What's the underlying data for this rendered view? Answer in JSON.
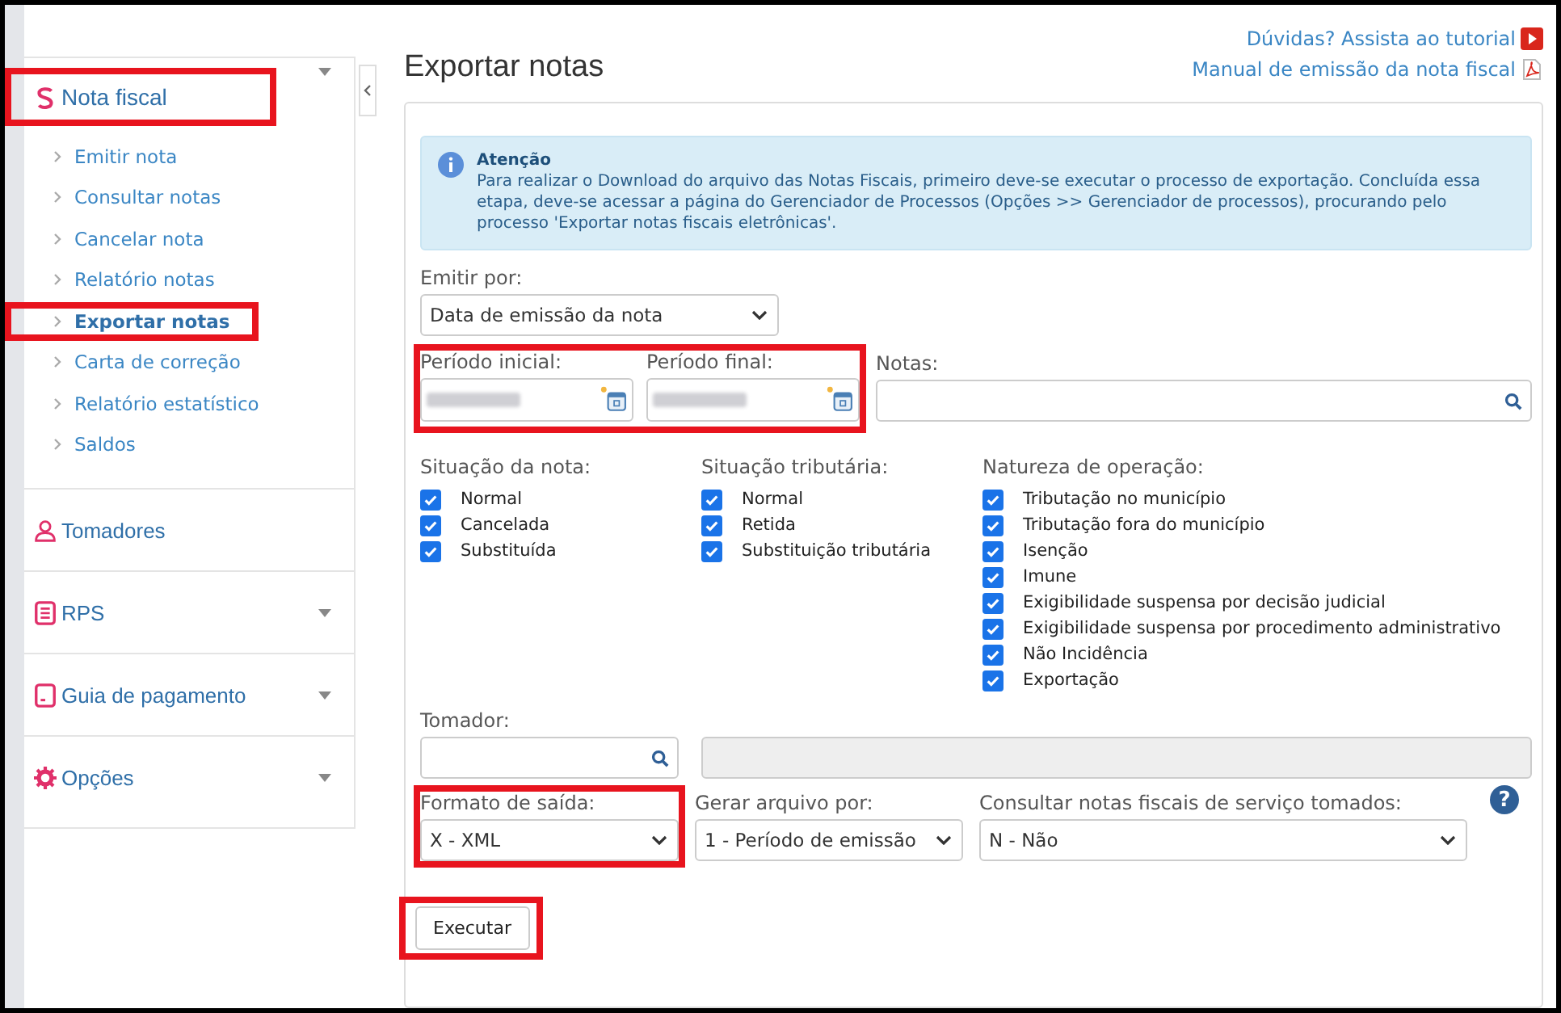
{
  "sidebar": {
    "sections": [
      {
        "label": "Nota fiscal",
        "kind": "nota",
        "collapsible": true,
        "highlighted": true,
        "items": [
          {
            "label": "Emitir nota",
            "selected": false,
            "highlighted": false
          },
          {
            "label": "Consultar notas",
            "selected": false,
            "highlighted": false
          },
          {
            "label": "Cancelar nota",
            "selected": false,
            "highlighted": false
          },
          {
            "label": "Relatório notas",
            "selected": false,
            "highlighted": false
          },
          {
            "label": "Exportar notas",
            "selected": true,
            "highlighted": true
          },
          {
            "label": "Carta de correção",
            "selected": false,
            "highlighted": false
          },
          {
            "label": "Relatório estatístico",
            "selected": false,
            "highlighted": false
          },
          {
            "label": "Saldos",
            "selected": false,
            "highlighted": false
          }
        ]
      },
      {
        "label": "Tomadores",
        "kind": "user",
        "collapsible": false,
        "highlighted": false
      },
      {
        "label": "RPS",
        "kind": "doc",
        "collapsible": true,
        "highlighted": false
      },
      {
        "label": "Guia de pagamento",
        "kind": "card",
        "collapsible": true,
        "highlighted": false
      },
      {
        "label": "Opções",
        "kind": "gear",
        "collapsible": true,
        "highlighted": false
      }
    ]
  },
  "page": {
    "title": "Exportar notas",
    "links": [
      {
        "label": "Dúvidas? Assista ao tutorial",
        "kind": "video"
      },
      {
        "label": "Manual de emissão da nota fiscal",
        "kind": "pdf"
      }
    ]
  },
  "notice": {
    "title": "Atenção",
    "text": "Para realizar o Download do arquivo das Notas Fiscais, primeiro deve-se executar o processo de exportação. Concluída essa etapa, deve-se acessar a página do Gerenciador de Processos (Opções >> Gerenciador de processos), procurando pelo processo 'Exportar notas fiscais eletrônicas'."
  },
  "emitir_por": {
    "label": "Emitir por:",
    "value": "Data de emissão da nota"
  },
  "periodo": {
    "highlighted": true,
    "fields": [
      {
        "label": "Período inicial:"
      },
      {
        "label": "Período final:"
      }
    ]
  },
  "notas": {
    "label": "Notas:"
  },
  "checkbox_groups": [
    {
      "label": "Situação da nota:",
      "options": [
        {
          "label": "Normal",
          "checked": true
        },
        {
          "label": "Cancelada",
          "checked": true
        },
        {
          "label": "Substituída",
          "checked": true
        }
      ]
    },
    {
      "label": "Situação tributária:",
      "options": [
        {
          "label": "Normal",
          "checked": true
        },
        {
          "label": "Retida",
          "checked": true
        },
        {
          "label": "Substituição tributária",
          "checked": true
        }
      ]
    },
    {
      "label": "Natureza de operação:",
      "options": [
        {
          "label": "Tributação no município",
          "checked": true
        },
        {
          "label": "Tributação fora do município",
          "checked": true
        },
        {
          "label": "Isenção",
          "checked": true
        },
        {
          "label": "Imune",
          "checked": true
        },
        {
          "label": "Exigibilidade suspensa por decisão judicial",
          "checked": true
        },
        {
          "label": "Exigibilidade suspensa por procedimento administrativo",
          "checked": true
        },
        {
          "label": "Não Incidência",
          "checked": true
        },
        {
          "label": "Exportação",
          "checked": true
        }
      ]
    }
  ],
  "tomador": {
    "label": "Tomador:"
  },
  "selects": [
    {
      "label": "Formato de saída:",
      "value": "X - XML",
      "highlighted": true
    },
    {
      "label": "Gerar arquivo por:",
      "value": "1 - Período de emissão",
      "highlighted": false
    },
    {
      "label": "Consultar notas fiscais de serviço tomados:",
      "value": "N - Não",
      "highlighted": false
    }
  ],
  "help": {
    "label": "?"
  },
  "execute": {
    "label": "Executar",
    "highlighted": true
  }
}
